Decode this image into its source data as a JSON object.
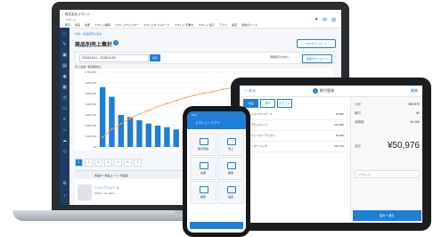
{
  "laptop": {
    "brand": "株式会社スマレジ",
    "brand_sub": "スマレジ",
    "nav": [
      "取引",
      "商品",
      "在庫",
      "スマレジ顧客",
      "スマレジウェイター",
      "スマレジタイムカード",
      "スマレジ 手書き",
      "スマレジ 電子",
      "アプリ",
      "設定",
      "会員ポイント"
    ],
    "breadcrumb": "分析 > 商品別売上集計",
    "page_title": "商品別売上集計",
    "download_btn": "CSVダウンロード",
    "date_range": "2018/11/01 - 2018/11/30",
    "show_btn": "表示",
    "filter_option": "明細取引を含む",
    "export_btn": "帳票ダウンロード",
    "legend": "売上金額 / 累積構成比",
    "pages": [
      "1",
      "2",
      "3",
      "4",
      "5",
      "6",
      "7"
    ],
    "table_headers": [
      "商品ID / 商品コード / 商品名",
      "部門名",
      "数量",
      "税抜売上",
      "粗利"
    ],
    "table_row": {
      "product": "シャツワンピース",
      "meta": "00015 / AC-0001",
      "dept": "ワンピース",
      "qty": "15",
      "sales": "¥85,000"
    }
  },
  "tablet": {
    "back": "＜ 戻る",
    "badge": "1",
    "title": "取引登録",
    "right_action": "編集",
    "tabs": [
      "商品",
      "部門",
      "カテゴリ"
    ],
    "items": [
      {
        "name": "シャツワンピース",
        "price": "¥8,800"
      },
      {
        "name": "デニムパンツ",
        "price": "¥12,000"
      },
      {
        "name": "ニットカーディガン",
        "price": "¥9,900"
      },
      {
        "name": "レザーバッグ",
        "price": "¥20,276"
      }
    ],
    "summary": [
      {
        "label": "小計",
        "value": "¥46,876"
      },
      {
        "label": "値引",
        "value": "¥0"
      },
      {
        "label": "消費税",
        "value": "¥4,100"
      }
    ],
    "total_label": "合計",
    "total": "¥50,976",
    "memo_placeholder": "メモを入力",
    "checkout": "会計へ進む"
  },
  "phone": {
    "time": "9:41",
    "title": "スマレジ・アプリ",
    "tiles": [
      "取引登録",
      "売上",
      "在庫",
      "顧客",
      "精算",
      "設定"
    ],
    "bottom": "メニュー"
  },
  "chart_data": {
    "type": "bar",
    "title": "",
    "xlabel": "",
    "ylabel": "",
    "ylim": [
      0,
      700000
    ],
    "values": [
      560000,
      470000,
      300000,
      280000,
      250000,
      220000,
      200000,
      185000,
      165000,
      150000,
      130000,
      118000,
      105000,
      98000,
      85000,
      78000,
      70000,
      62000,
      55000,
      48000,
      42000,
      36000,
      30000,
      26000,
      22000
    ],
    "cumulative": [
      0.13,
      0.24,
      0.31,
      0.38,
      0.44,
      0.49,
      0.54,
      0.58,
      0.62,
      0.66,
      0.69,
      0.72,
      0.74,
      0.77,
      0.79,
      0.81,
      0.83,
      0.84,
      0.86,
      0.87,
      0.88,
      0.89,
      0.9,
      0.91,
      0.92
    ],
    "yticks": [
      "¥700,000",
      "¥600,000",
      "¥500,000",
      "¥400,000",
      "¥300,000",
      "¥200,000",
      "¥100,000",
      "¥0"
    ],
    "bar_color": "#1e7fd6",
    "line_color": "#f0a43a"
  },
  "colors": {
    "accent": "#1e7fd6",
    "sidebar": "#1f3c61"
  }
}
